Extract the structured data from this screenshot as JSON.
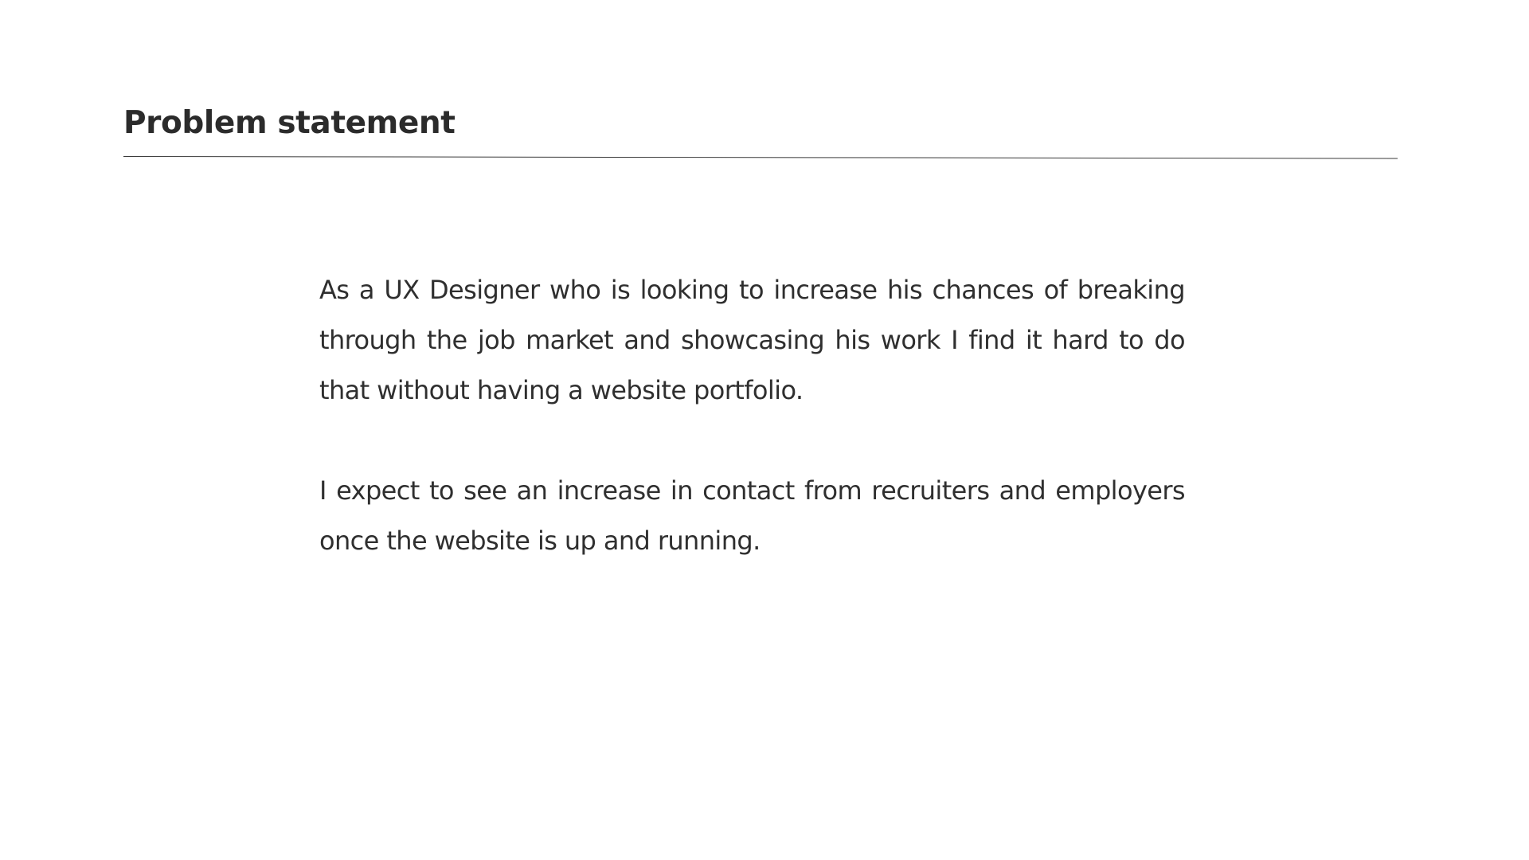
{
  "slide": {
    "title": "Problem statement",
    "paragraphs": [
      "As a UX Designer who is looking to increase his chances of breaking through the job market and showcasing his work I find it hard to do that without having a website portfolio.",
      "I expect to see an increase in contact from recruiters and employers once the website is up and running."
    ]
  },
  "colors": {
    "background": "#ffffff",
    "text": "#2b2b2b",
    "rule": "#3a3a3a"
  }
}
